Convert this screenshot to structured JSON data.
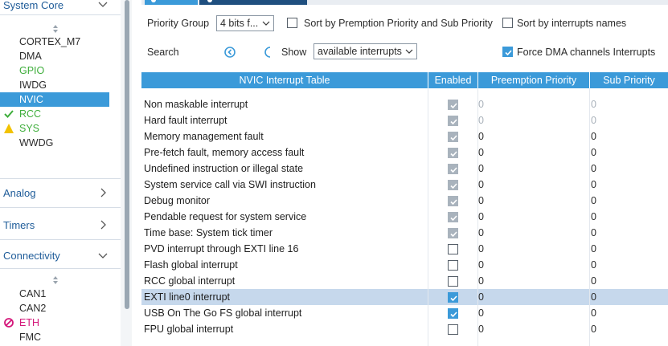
{
  "sidebar": {
    "categories": {
      "system_core": "System Core",
      "analog": "Analog",
      "timers": "Timers",
      "connectivity": "Connectivity"
    },
    "system_core_items": [
      {
        "label": "CORTEX_M7",
        "status": "none"
      },
      {
        "label": "DMA",
        "status": "none"
      },
      {
        "label": "GPIO",
        "status": "configured"
      },
      {
        "label": "IWDG",
        "status": "none"
      },
      {
        "label": "NVIC",
        "status": "selected"
      },
      {
        "label": "RCC",
        "status": "ok"
      },
      {
        "label": "SYS",
        "status": "warning"
      },
      {
        "label": "WWDG",
        "status": "none"
      }
    ],
    "connectivity_items": [
      {
        "label": "CAN1",
        "status": "none"
      },
      {
        "label": "CAN2",
        "status": "none"
      },
      {
        "label": "ETH",
        "status": "error"
      },
      {
        "label": "FMC",
        "status": "none"
      }
    ]
  },
  "controls": {
    "priority_group_label": "Priority Group",
    "priority_group_value": "4 bits f...",
    "sort_priority_label": "Sort by Premption Priority and Sub Priority",
    "sort_priority_checked": false,
    "sort_names_label": "Sort by interrupts names",
    "sort_names_checked": false,
    "search_label": "Search",
    "show_label": "Show",
    "show_value": "available interrupts",
    "force_dma_label": "Force DMA channels Interrupts",
    "force_dma_checked": true
  },
  "table": {
    "headers": {
      "name": "NVIC Interrupt Table",
      "enabled": "Enabled",
      "preemption": "Preemption Priority",
      "sub": "Sub Priority"
    },
    "rows": [
      {
        "name": "Non maskable interrupt",
        "enabled": "locked",
        "preemption": "0",
        "sub": "0",
        "grayed": true
      },
      {
        "name": "Hard fault interrupt",
        "enabled": "locked",
        "preemption": "0",
        "sub": "0",
        "grayed": true
      },
      {
        "name": "Memory management fault",
        "enabled": "locked",
        "preemption": "0",
        "sub": "0",
        "grayed": false
      },
      {
        "name": "Pre-fetch fault, memory access fault",
        "enabled": "locked",
        "preemption": "0",
        "sub": "0",
        "grayed": false
      },
      {
        "name": "Undefined instruction or illegal state",
        "enabled": "locked",
        "preemption": "0",
        "sub": "0",
        "grayed": false
      },
      {
        "name": "System service call via SWI instruction",
        "enabled": "locked",
        "preemption": "0",
        "sub": "0",
        "grayed": false
      },
      {
        "name": "Debug monitor",
        "enabled": "locked",
        "preemption": "0",
        "sub": "0",
        "grayed": false
      },
      {
        "name": "Pendable request for system service",
        "enabled": "locked",
        "preemption": "0",
        "sub": "0",
        "grayed": false
      },
      {
        "name": "Time base: System tick timer",
        "enabled": "locked",
        "preemption": "0",
        "sub": "0",
        "grayed": false
      },
      {
        "name": "PVD interrupt through EXTI line 16",
        "enabled": "off",
        "preemption": "0",
        "sub": "0",
        "grayed": false
      },
      {
        "name": "Flash global interrupt",
        "enabled": "off",
        "preemption": "0",
        "sub": "0",
        "grayed": false
      },
      {
        "name": "RCC global interrupt",
        "enabled": "off",
        "preemption": "0",
        "sub": "0",
        "grayed": false
      },
      {
        "name": "EXTI line0 interrupt",
        "enabled": "on",
        "preemption": "0",
        "sub": "0",
        "grayed": false,
        "highlighted": true
      },
      {
        "name": "USB On The Go FS global interrupt",
        "enabled": "on",
        "preemption": "0",
        "sub": "0",
        "grayed": false
      },
      {
        "name": "FPU global interrupt",
        "enabled": "off",
        "preemption": "0",
        "sub": "0",
        "grayed": false
      }
    ]
  },
  "colors": {
    "accent": "#3b9ad9",
    "tab_dark": "#1f4f7f",
    "ok_green": "#3fae3c",
    "warning_yellow": "#f2c200",
    "error_pink": "#d4177a",
    "row_highlight": "#c6d8ec"
  }
}
